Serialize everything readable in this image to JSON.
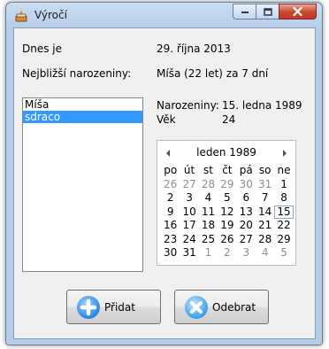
{
  "window": {
    "title": "Výročí"
  },
  "today": {
    "label": "Dnes je",
    "value": "29. října 2013"
  },
  "next_birthday": {
    "label": "Nejbližší narozeniny:",
    "value": "Míša (22 let) za 7 dní"
  },
  "people": {
    "items": [
      {
        "name": "Míša",
        "selected": false
      },
      {
        "name": "sdraco",
        "selected": true
      }
    ]
  },
  "details": {
    "birthday_label": "Narozeniny:",
    "birthday_value": "15. ledna 1989",
    "age_label": "Věk",
    "age_value": "24"
  },
  "calendar": {
    "month_title": "leden 1989",
    "weekdays": [
      "po",
      "út",
      "st",
      "čt",
      "pá",
      "so",
      "ne"
    ],
    "weeks": [
      [
        "26",
        "27",
        "28",
        "29",
        "30",
        "31",
        "1"
      ],
      [
        "2",
        "3",
        "4",
        "5",
        "6",
        "7",
        "8"
      ],
      [
        "9",
        "10",
        "11",
        "12",
        "13",
        "14",
        "15"
      ],
      [
        "16",
        "17",
        "18",
        "19",
        "20",
        "21",
        "22"
      ],
      [
        "23",
        "24",
        "25",
        "26",
        "27",
        "28",
        "29"
      ],
      [
        "30",
        "31",
        "1",
        "2",
        "3",
        "4",
        "5"
      ]
    ],
    "selected_day": "15"
  },
  "buttons": {
    "add_label": "Přidat",
    "remove_label": "Odebrat"
  }
}
